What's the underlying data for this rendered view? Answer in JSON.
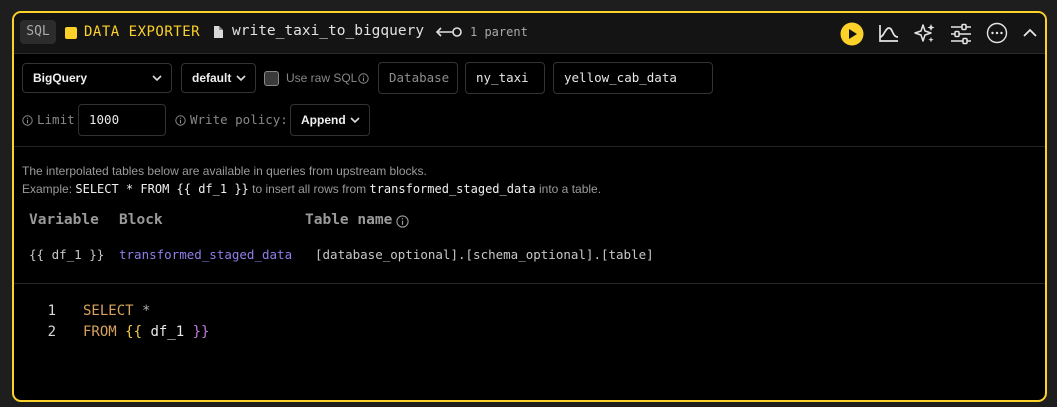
{
  "header": {
    "lang_badge": "SQL",
    "block_type": "DATA EXPORTER",
    "file_name": "write_taxi_to_bigquery",
    "parents": "1 parent",
    "accent": "#fcd12a",
    "icons": [
      "play-icon",
      "chart-icon",
      "sparkle-icon",
      "sliders-icon",
      "more-icon",
      "chevron-up-icon"
    ]
  },
  "config": {
    "data_source": "BigQuery",
    "profile": "default",
    "use_raw_sql_label": "Use raw SQL",
    "database_placeholder": "Database",
    "schema": "ny_taxi",
    "table": "yellow_cab_data",
    "limit_label": "Limit",
    "limit_value": "1000",
    "write_policy_label": "Write policy:",
    "write_policy": "Append"
  },
  "description": {
    "line1": "The interpolated tables below are available in queries from upstream blocks.",
    "example_prefix": "Example:",
    "example_code": "SELECT * FROM {{ df_1 }}",
    "example_mid": "to insert all rows from",
    "example_block": "transformed_staged_data",
    "example_suffix": "into a table."
  },
  "table": {
    "headers": [
      "Variable",
      "Block",
      "Table name"
    ],
    "rows": [
      {
        "variable": "{{ df_1 }}",
        "block": "transformed_staged_data",
        "table_name": "[database_optional].[schema_optional].[table]"
      }
    ]
  },
  "editor": {
    "lines": [
      {
        "num": "1",
        "keyword": "SELECT",
        "rest": "*"
      },
      {
        "num": "2",
        "keyword": "FROM",
        "open": "{{",
        "var": "df_1",
        "close": "}}"
      }
    ]
  }
}
